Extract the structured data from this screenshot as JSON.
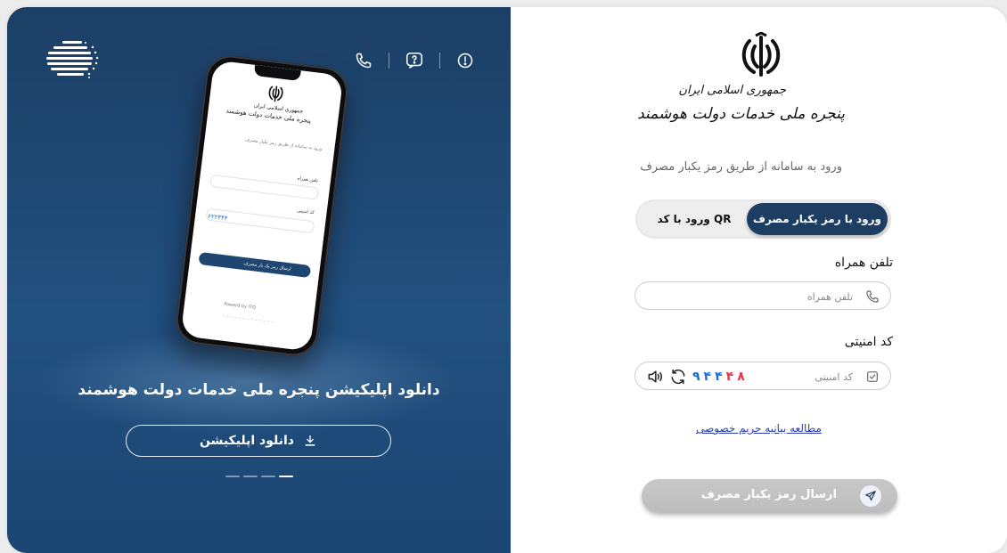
{
  "promo": {
    "title": "دانلود اپلیکیشن پنجره ملی خدمات دولت هوشمند",
    "download_label": "دانلود اپلیکیشن",
    "slides": 4,
    "active_slide": 4,
    "icons": [
      "phone-icon",
      "help-icon",
      "info-icon"
    ],
    "phone_screen": {
      "brand_line1": "جمهوری اسلامی ایران",
      "brand_line2": "پنجره ملی خدمات دولت هوشمند",
      "subtitle": "ورود به سامانه از طریق رمز یکبار مصرف",
      "phone_label": "تلفن همراه",
      "captcha_label": "کد امنیتی",
      "captcha": "۶۲۲۳۴۴",
      "send_label": "ارسال رمز یک بار مصرف",
      "powered": "Powerd by ITO"
    }
  },
  "login": {
    "brand_line1": "جمهوری اسلامی ایران",
    "brand_line2": "پنجره ملی خدمات دولت هوشمند",
    "subtitle": "ورود به سامانه از طریق رمز یکبار مصرف",
    "tabs": [
      {
        "label": "ورود با رمز یکبار مصرف",
        "active": true
      },
      {
        "label": "ورود با کد QR",
        "active": false
      }
    ],
    "phone": {
      "label": "تلفن همراه",
      "placeholder": "تلفن همراه",
      "value": ""
    },
    "captcha": {
      "label": "کد امنیتی",
      "placeholder": "کد امنیتی",
      "value": "",
      "digits": [
        "۹",
        "۴",
        "۴",
        "۴",
        "۸"
      ]
    },
    "privacy_link": "مطالعه بیانیه حریم خصوصی",
    "submit_label": "ارسال رمز یکبار مصرف"
  },
  "colors": {
    "primary": "#1d3d62",
    "panel": "#22507f",
    "link": "#2a3eb1",
    "captcha_blue": "#1a6dd6",
    "captcha_red": "#e03a50",
    "disabled": "#c4c4c4"
  }
}
